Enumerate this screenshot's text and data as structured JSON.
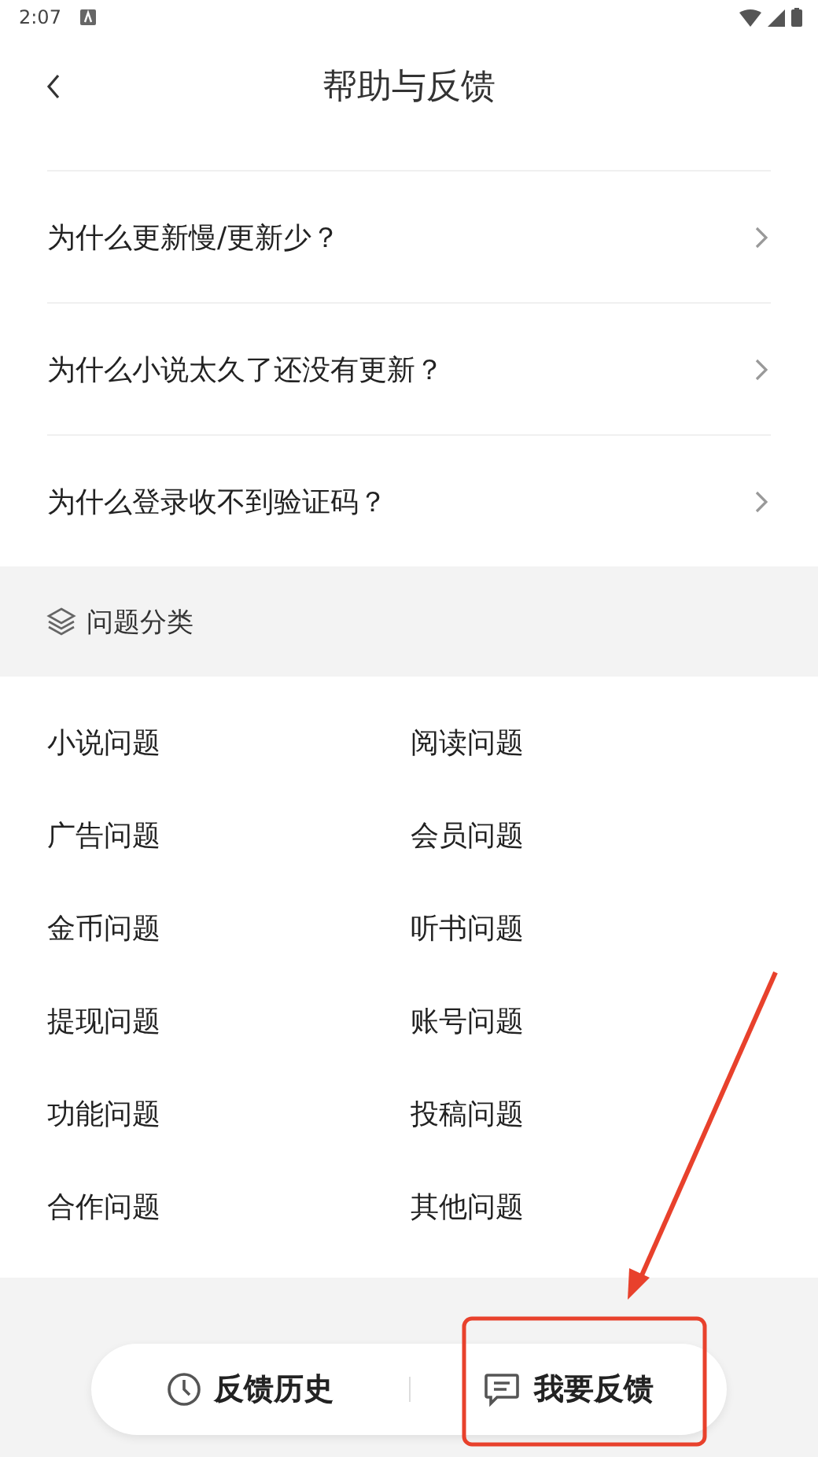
{
  "status_bar": {
    "time": "2:07"
  },
  "header": {
    "title": "帮助与反馈"
  },
  "faq": [
    {
      "question": "为什么更新慢/更新少？"
    },
    {
      "question": "为什么小说太久了还没有更新？"
    },
    {
      "question": "为什么登录收不到验证码？"
    }
  ],
  "categories": {
    "title": "问题分类",
    "items": [
      "小说问题",
      "阅读问题",
      "广告问题",
      "会员问题",
      "金币问题",
      "听书问题",
      "提现问题",
      "账号问题",
      "功能问题",
      "投稿问题",
      "合作问题",
      "其他问题"
    ]
  },
  "bottom_bar": {
    "history_button": "反馈历史",
    "feedback_button": "我要反馈"
  }
}
